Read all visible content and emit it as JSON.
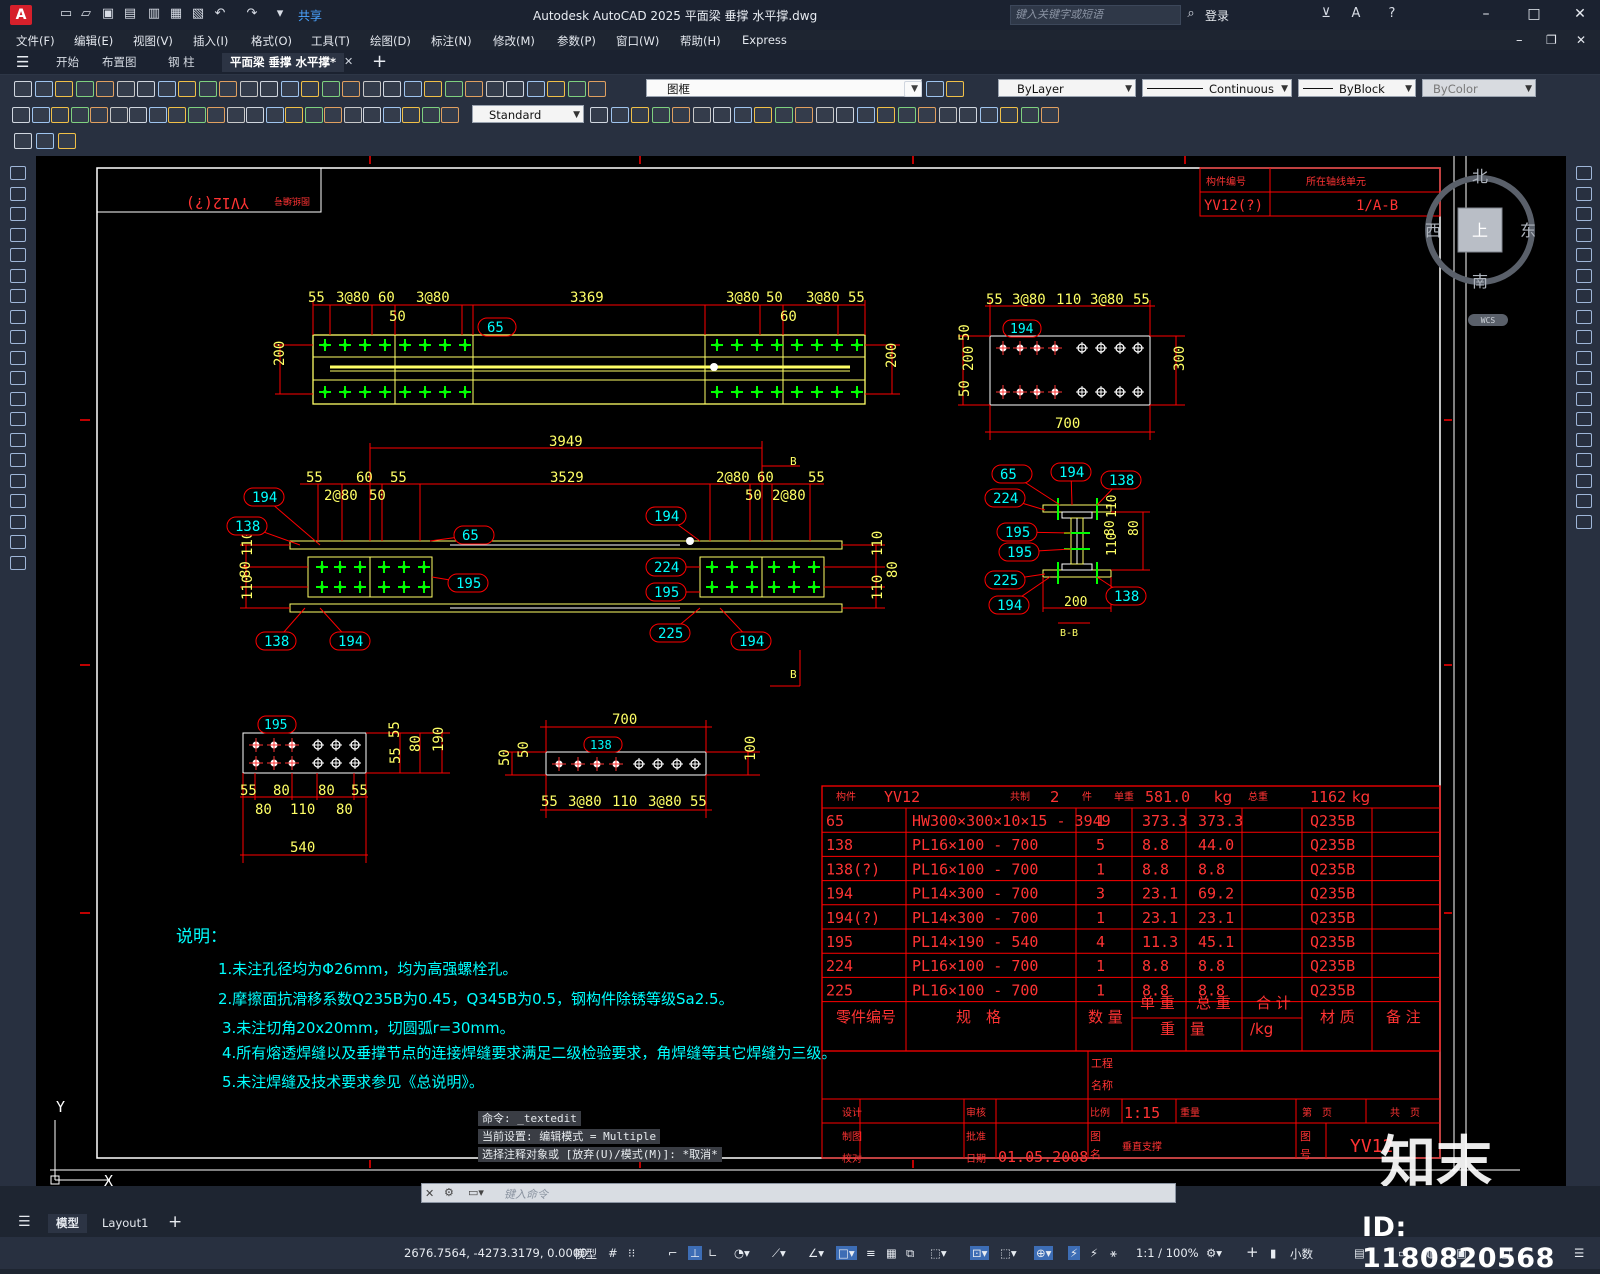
{
  "titlebar": {
    "app_logo": "A",
    "share_label": "共享",
    "window_title": "Autodesk AutoCAD 2025    平面梁 垂撑 水平撑.dwg",
    "search_placeholder": "键入关键字或短语",
    "login_label": "登录"
  },
  "menu": [
    "文件(F)",
    "编辑(E)",
    "视图(V)",
    "插入(I)",
    "格式(O)",
    "工具(T)",
    "绘图(D)",
    "标注(N)",
    "修改(M)",
    "参数(P)",
    "窗口(W)",
    "帮助(H)",
    "Express"
  ],
  "tabs": [
    "开始",
    "布置图",
    "钢 柱",
    "平面梁 垂撑 水平撑*"
  ],
  "properties": {
    "layer": "图框",
    "color": "ByLayer",
    "linetype": "Continuous",
    "lineweight": "ByBlock",
    "plotstyle": "ByColor",
    "textstyle": "Standard"
  },
  "viewcube": {
    "north": "北",
    "south": "南",
    "east": "东",
    "west": "西",
    "top": "上",
    "wcs": "WCS"
  },
  "drawing": {
    "title_box_label": "图纸编号",
    "title_box_code": "YV12(?)",
    "top_table": {
      "h1": "构件编号",
      "h2": "所在轴线单元",
      "v1": "YV12(?)",
      "v2": "1/A-B"
    },
    "top_view": {
      "dims_top": [
        "55",
        "3@80",
        "60",
        "3@80",
        "3369",
        "3@80",
        "50",
        "3@80",
        "55"
      ],
      "dims_sub": [
        "50",
        "60"
      ],
      "side_dims": [
        "200",
        "200"
      ],
      "tag": "65"
    },
    "plate_300": {
      "dims_top": [
        "55",
        "3@80",
        "110",
        "3@80",
        "55"
      ],
      "side": [
        "50",
        "200",
        "50",
        "300"
      ],
      "bottom": "700",
      "tag": "194"
    },
    "elevation": {
      "overall": "3949",
      "inner": "3529",
      "dims_left": [
        "55",
        "60",
        "2@80",
        "50"
      ],
      "dims_right": [
        "2@80",
        "60",
        "55",
        "50",
        "2@80"
      ],
      "side_left": [
        "110",
        "80",
        "110"
      ],
      "side_right": [
        "110",
        "80",
        "110"
      ],
      "section_mark": "B",
      "tags": [
        "194",
        "138",
        "65",
        "195",
        "138",
        "194",
        "194",
        "224",
        "195",
        "225",
        "194"
      ]
    },
    "section_bb": {
      "tags": [
        "65",
        "194",
        "138",
        "224",
        "195",
        "195",
        "225",
        "194",
        "138"
      ],
      "dims": [
        "110",
        "80",
        "80",
        "110",
        "200"
      ],
      "label": "B-B"
    },
    "plate_195": {
      "tag": "195",
      "side": [
        "55",
        "80",
        "55",
        "190"
      ],
      "bottom": [
        "55",
        "80",
        "110",
        "80",
        "55"
      ],
      "overall": "540"
    },
    "plate_138": {
      "overall": "700",
      "tag": "138",
      "side": [
        "50",
        "50",
        "100"
      ],
      "bottom": [
        "55",
        "3@80",
        "110",
        "3@80",
        "55"
      ]
    },
    "notes": {
      "title": "说明：",
      "items": [
        "1.未注孔径均为Φ26mm，均为高强螺栓孔。",
        "2.摩擦面抗滑移系数Q235B为0.45，Q345B为0.5，钢构件除锈等级Sa2.5。",
        "3.未注切角20x20mm，切圆弧r=30mm。",
        "4.所有熔透焊缝以及垂撑节点的连接焊缝要求满足二级检验要求，角焊缝等其它焊缝为三级。",
        "5.未注焊缝及技术要求参见《总说明》。"
      ]
    },
    "parts_table": {
      "header": {
        "l1": "构件",
        "v1": "YV12",
        "l2": "共制",
        "v2": "2",
        "l3": "件",
        "l4": "单重",
        "v4": "581.0",
        "u4": "kg",
        "l5": "总重",
        "v5": "1162",
        "u5": "kg"
      },
      "rows": [
        [
          "65",
          "HW300×300×10×15 - 3949",
          "1",
          "373.3",
          "373.3",
          "Q235B"
        ],
        [
          "138",
          "PL16×100 - 700",
          "5",
          "8.8",
          "44.0",
          "Q235B"
        ],
        [
          "138(?)",
          "PL16×100 - 700",
          "1",
          "8.8",
          "8.8",
          "Q235B"
        ],
        [
          "194",
          "PL14×300 - 700",
          "3",
          "23.1",
          "69.2",
          "Q235B"
        ],
        [
          "194(?)",
          "PL14×300 - 700",
          "1",
          "23.1",
          "23.1",
          "Q235B"
        ],
        [
          "195",
          "PL14×190 - 540",
          "4",
          "11.3",
          "45.1",
          "Q235B"
        ],
        [
          "224",
          "PL16×100 - 700",
          "1",
          "8.8",
          "8.8",
          "Q235B"
        ],
        [
          "225",
          "PL16×100 - 700",
          "1",
          "8.8",
          "8.8",
          "Q235B"
        ]
      ],
      "footer": {
        "c1": "零件编号",
        "c2": "规　格",
        "c3": "数 量",
        "c4a": "单 重",
        "c4b": "总 重",
        "c4c": "合 计",
        "c4d": "重　量",
        "c4e": "/kg",
        "c5": "材 质",
        "c6": "备 注"
      }
    },
    "title_block": {
      "proj_l1": "工程",
      "proj_l2": "名称",
      "design": "设计",
      "draw": "制图",
      "check": "校对",
      "review": "审核",
      "approve": "批准",
      "date_l": "日期",
      "date": "01.05.2008",
      "scale_l": "比例",
      "scale": "1:15",
      "weight": "重量",
      "sheet_l1": "第　页",
      "sheet_l2": "共　页",
      "dname_l1": "图",
      "dname_l2": "名",
      "dname": "垂直支撑",
      "dno_l1": "图",
      "dno_l2": "号",
      "dno": "YV12"
    }
  },
  "commandline": {
    "history": [
      "命令: _textedit",
      "当前设置: 编辑模式 = Multiple",
      "选择注释对象或 [放弃(U)/模式(M)]: *取消*"
    ],
    "placeholder": "键入命令"
  },
  "layout_tabs": [
    "模型",
    "Layout1"
  ],
  "status": {
    "coords": "2676.7564, -4273.3179, 0.0000",
    "model": "模型",
    "scale": "1:1 / 100%",
    "units": "小数"
  },
  "watermark": {
    "brand": "知末",
    "id": "ID: 1180820568"
  },
  "colors": {
    "canvas": "#000000",
    "red": "#ff0000",
    "cyan": "#00ffff",
    "yellow": "#ffff00",
    "green": "#00ff00",
    "ui_bg": "#283040"
  }
}
